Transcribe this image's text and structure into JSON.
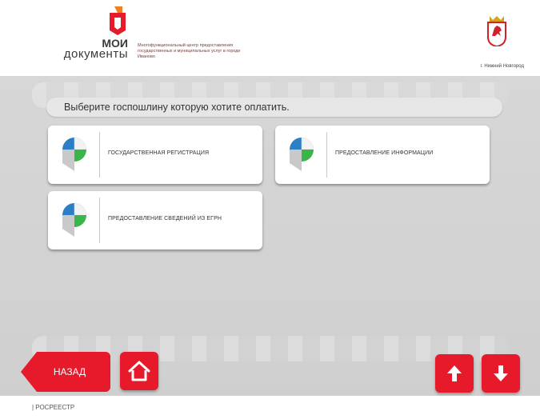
{
  "header": {
    "logo_line1": "МОИ",
    "logo_line2": "документы",
    "description": "Многофункциональный центр предоставления государственных и муниципальных услуг в городе Иваново",
    "city": "г. Нижний Новгород",
    "brand_color": "#e61a2a"
  },
  "main": {
    "prompt": "Выберите госпошлину которую хотите оплатить.",
    "tiles": [
      {
        "label": "ГОСУДАРСТВЕННАЯ РЕГИСТРАЦИЯ",
        "icon": "rosreestr-logo-icon"
      },
      {
        "label": "ПРЕДОСТАВЛЕНИЕ ИНФОРМАЦИИ",
        "icon": "rosreestr-logo-icon"
      },
      {
        "label": "ПРЕДОСТАВЛЕНИЕ СВЕДЕНИЙ ИЗ ЕГРН",
        "icon": "rosreestr-logo-icon"
      }
    ]
  },
  "nav": {
    "back_label": "НАЗАД",
    "home_icon": "home-icon",
    "up_icon": "arrow-up-icon",
    "down_icon": "arrow-down-icon"
  },
  "footer": {
    "text": "|  РОСРЕЕСТР"
  }
}
